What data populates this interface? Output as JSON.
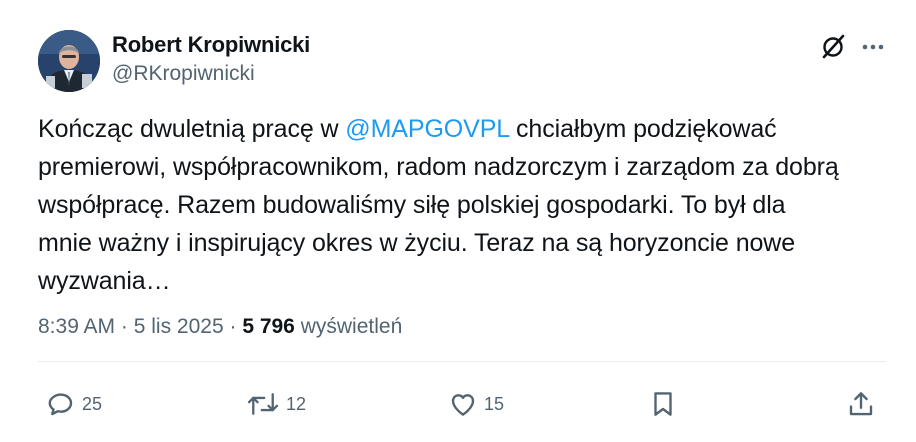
{
  "author": {
    "name": "Robert Kropiwnicki",
    "handle": "@RKropiwnicki"
  },
  "tweet": {
    "text_before": "Kończąc dwuletnią pracę w ",
    "mention": "@MAPGOVPL",
    "text_after": " chciałbym podziękować\npremierowi, współpracownikom, radom nadzorczym i zarządom za dobrą\nwspółpracę. Razem budowaliśmy siłę polskiej gospodarki. To był dla\nmnie ważny i inspirujący okres w życiu. Teraz na są horyzoncie nowe\nwyzwania…"
  },
  "meta": {
    "time": "8:39 AM",
    "separator": " · ",
    "date": "5 lis 2025",
    "views_count": "5 796",
    "views_label": "wyświetleń"
  },
  "actions": {
    "replies": "25",
    "reposts": "12",
    "likes": "15"
  },
  "icons": {
    "avatar": "avatar-photo",
    "grok": "grok-icon",
    "more": "more-icon",
    "reply": "reply-icon",
    "repost": "repost-icon",
    "like": "heart-icon",
    "bookmark": "bookmark-icon",
    "share": "share-icon"
  },
  "colors": {
    "accent": "#1d9bf0",
    "secondary_text": "#536471",
    "primary_text": "#0f1419"
  }
}
